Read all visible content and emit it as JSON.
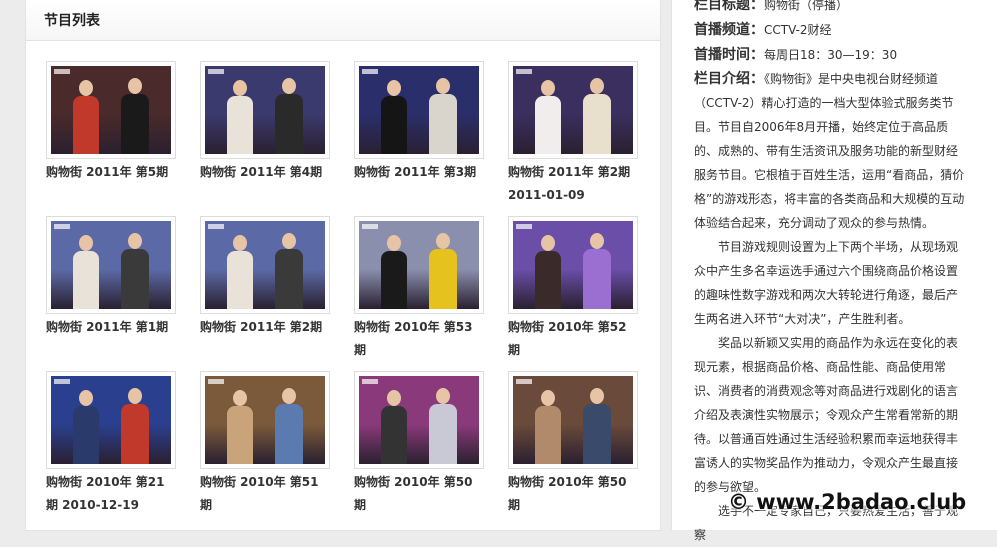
{
  "list_panel": {
    "title": "节目列表"
  },
  "programs": [
    {
      "caption": "购物街 2011年 第5期",
      "palette": [
        "#4a2a2a",
        "#c0392b",
        "#1a1a1a"
      ]
    },
    {
      "caption": "购物街 2011年 第4期",
      "palette": [
        "#3b3a6e",
        "#e8e2d8",
        "#2a2a2a"
      ]
    },
    {
      "caption": "购物街 2011年 第3期",
      "palette": [
        "#2a2f6b",
        "#151515",
        "#d9d5cc"
      ]
    },
    {
      "caption": "购物街 2011年 第2期 2011-01-09",
      "palette": [
        "#3a2f5e",
        "#f2eded",
        "#e8e0cc"
      ]
    },
    {
      "caption": "购物街 2011年 第1期",
      "palette": [
        "#5b6aa6",
        "#e8e2d8",
        "#3a3a3a"
      ]
    },
    {
      "caption": "购物街 2011年 第2期",
      "palette": [
        "#5b6aa6",
        "#e8e2d8",
        "#3a3a3a"
      ]
    },
    {
      "caption": "购物街 2010年 第53期",
      "palette": [
        "#8a8fae",
        "#1a1a1a",
        "#e5c21d"
      ]
    },
    {
      "caption": "购物街 2010年 第52期",
      "palette": [
        "#6a4ea8",
        "#3a2a2a",
        "#9a6fd1"
      ]
    },
    {
      "caption": "购物街 2010年 第21期 2010-12-19",
      "palette": [
        "#2b3f8f",
        "#2a3a6a",
        "#c0392b"
      ]
    },
    {
      "caption": "购物街 2010年 第51期",
      "palette": [
        "#7a5a3a",
        "#c9a37a",
        "#5a7ab0"
      ]
    },
    {
      "caption": "购物街 2010年 第50期",
      "palette": [
        "#8a3a7a",
        "#333333",
        "#c9c9d6"
      ]
    },
    {
      "caption": "购物街 2010年 第50期",
      "palette": [
        "#6a4a3a",
        "#b08a6a",
        "#3a4a6a"
      ]
    }
  ],
  "info": {
    "column_title_label": "栏目标题：",
    "column_title_value": "购物街（停播）",
    "channel_label": "首播频道：",
    "channel_value": "CCTV-2财经",
    "time_label": "首播时间：",
    "time_value": "每周日18：30—19：30",
    "intro_label": "栏目介绍：",
    "intro_first": "《购物街》是中央电视台财经频道（CCTV-2）精心打造的一档大型体验式服务类节目。节目自2006年8月开播，始终定位于高品质的、成熟的、带有生活资讯及服务功能的新型财经服务节目。它根植于百姓生活，运用“看商品，猜价格”的游戏形态，将丰富的各类商品和大规模的互动体验结合起来，充分调动了观众的参与热情。",
    "paragraph_2": "节目游戏规则设置为上下两个半场，从现场观众中产生多名幸运选手通过六个围绕商品价格设置的趣味性数字游戏和两次大转轮进行角逐，最后产生两名进入环节“大对决”，产生胜利者。",
    "paragraph_3": "奖品以新颖又实用的商品作为永远在变化的表现元素，根据商品价格、商品性能、商品使用常识、消费者的消费观念等对商品进行戏剧化的语言介绍及表演性实物展示；令观众产生常看常新的期待。以普通百姓通过生活经验积累而幸运地获得丰富诱人的实物奖品作为推动力，令观众产生最直接的参与欲望。",
    "paragraph_4": "选手不一定专家自己，只要热爱生活，善于观察"
  },
  "watermark": {
    "text": "© www.2badao.club"
  }
}
